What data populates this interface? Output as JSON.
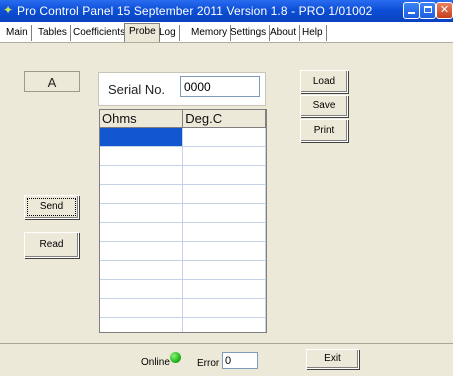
{
  "window": {
    "title": "Pro Control Panel 15 September 2011 Version 1.8 - PRO 1/01002"
  },
  "tabs": [
    {
      "label": "Main"
    },
    {
      "label": "Tables"
    },
    {
      "label": "Coefficients"
    },
    {
      "label": "Probe",
      "active": true
    },
    {
      "label": "Log"
    },
    {
      "label": "Memory"
    },
    {
      "label": "Settings"
    },
    {
      "label": "About"
    },
    {
      "label": "Help"
    }
  ],
  "probe": {
    "channel_label": "A",
    "serial_label": "Serial No.",
    "serial_value": "0000",
    "table": {
      "columns": [
        "Ohms",
        "Deg.C"
      ],
      "selected_row": 0
    },
    "buttons": {
      "load": "Load",
      "save": "Save",
      "print": "Print",
      "send": "Send",
      "read": "Read"
    }
  },
  "status": {
    "online_label": "Online",
    "online_color": "#2cbf1f",
    "error_label": "Error",
    "error_value": "0",
    "exit_label": "Exit"
  },
  "colors": {
    "titlebar": "#0d4fd6",
    "selection": "#1257d0",
    "face": "#ece9d8"
  }
}
